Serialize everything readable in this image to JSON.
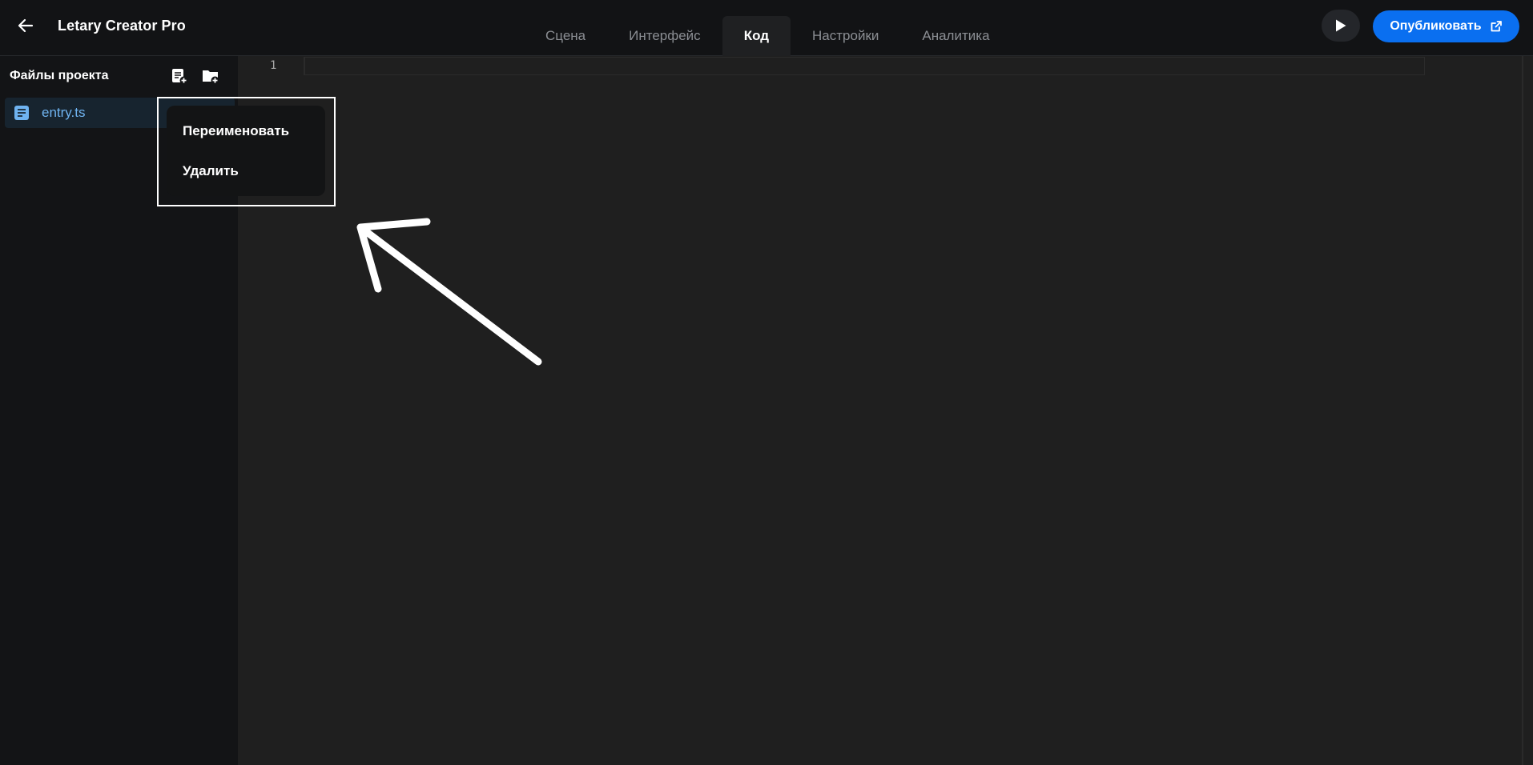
{
  "header": {
    "title": "Letary Creator Pro",
    "tabs": [
      {
        "label": "Сцена",
        "active": false
      },
      {
        "label": "Интерфейс",
        "active": false
      },
      {
        "label": "Код",
        "active": true
      },
      {
        "label": "Настройки",
        "active": false
      },
      {
        "label": "Аналитика",
        "active": false
      }
    ],
    "publish_label": "Опубликовать",
    "icons": {
      "back": "arrow-left-icon",
      "play": "play-icon",
      "external": "external-link-icon"
    }
  },
  "sidebar": {
    "title": "Файлы проекта",
    "icons": {
      "new_file": "add-file-icon",
      "new_folder": "add-folder-icon"
    },
    "files": [
      {
        "name": "entry.ts",
        "icon": "file-icon",
        "selected": true
      }
    ]
  },
  "editor": {
    "line_numbers": [
      "1"
    ]
  },
  "context_menu": {
    "items": [
      "Переименовать",
      "Удалить"
    ]
  },
  "colors": {
    "accent": "#0a6ff0",
    "file_name": "#6fb3f0",
    "background": "#1f1f1f",
    "sidebar": "#131416"
  }
}
